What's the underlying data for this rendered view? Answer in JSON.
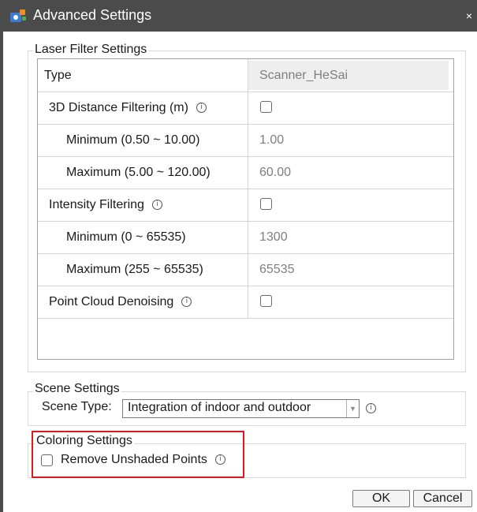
{
  "window": {
    "title": "Advanced Settings",
    "close_glyph": "×",
    "app_icon": "app-icon"
  },
  "laser_filter": {
    "legend": "Laser Filter Settings",
    "rows": [
      {
        "label": "Type",
        "value": "Scanner_HeSai",
        "kind": "readonly"
      },
      {
        "label": "3D Distance Filtering (m)",
        "info": true,
        "kind": "checkbox",
        "checked": false
      },
      {
        "label": "Minimum (0.50 ~ 10.00)",
        "value": "1.00",
        "kind": "value"
      },
      {
        "label": "Maximum (5.00 ~ 120.00)",
        "value": "60.00",
        "kind": "value"
      },
      {
        "label": "Intensity Filtering",
        "info": true,
        "kind": "checkbox",
        "checked": false
      },
      {
        "label": "Minimum (0 ~ 65535)",
        "value": "1300",
        "kind": "value"
      },
      {
        "label": "Maximum (255 ~ 65535)",
        "value": "65535",
        "kind": "value"
      },
      {
        "label": "Point Cloud Denoising",
        "info": true,
        "kind": "checkbox",
        "checked": false
      }
    ]
  },
  "scene": {
    "legend": "Scene Settings",
    "type_label": "Scene Type:",
    "type_value": "Integration of indoor and outdoor"
  },
  "coloring": {
    "legend": "Coloring Settings",
    "remove_unshaded_label": "Remove Unshaded Points",
    "remove_unshaded_checked": false,
    "highlight_color": "#e0191f"
  },
  "buttons": {
    "ok": "OK",
    "cancel": "Cancel"
  },
  "info_glyph": "i"
}
